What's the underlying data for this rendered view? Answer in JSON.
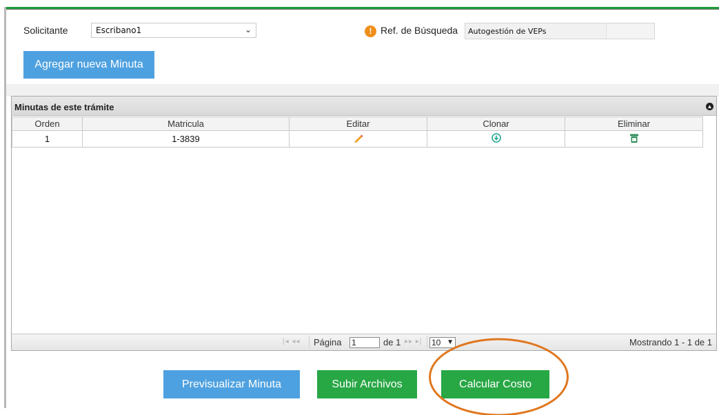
{
  "form": {
    "solicitante_label": "Solicitante",
    "solicitante_value": "Escribano1",
    "ref_label": "Ref. de Búsqueda",
    "ref_value": "Autogestión de VEPs",
    "agregar_label": "Agregar nueva Minuta"
  },
  "grid": {
    "caption": "Minutas de este trámite",
    "columns": [
      "Orden",
      "Matricula",
      "Editar",
      "Clonar",
      "Eliminar"
    ],
    "rows": [
      {
        "orden": "1",
        "matricula": "1-3839",
        "editar_icon": "pencil-icon",
        "clonar_icon": "clone-icon",
        "eliminar_icon": "trash-icon"
      }
    ],
    "pager": {
      "pagina_label": "Página",
      "page_value": "1",
      "de_label": "de 1",
      "page_size": "10",
      "status": "Mostrando 1 - 1 de 1"
    }
  },
  "actions": {
    "previsualizar": "Previsualizar Minuta",
    "subir": "Subir Archivos",
    "calcular": "Calcular Costo"
  },
  "colors": {
    "accent_green": "#28a745",
    "accent_blue": "#4ea1e0",
    "highlight_orange": "#e0771e",
    "warning_orange": "#ef8e1a"
  }
}
